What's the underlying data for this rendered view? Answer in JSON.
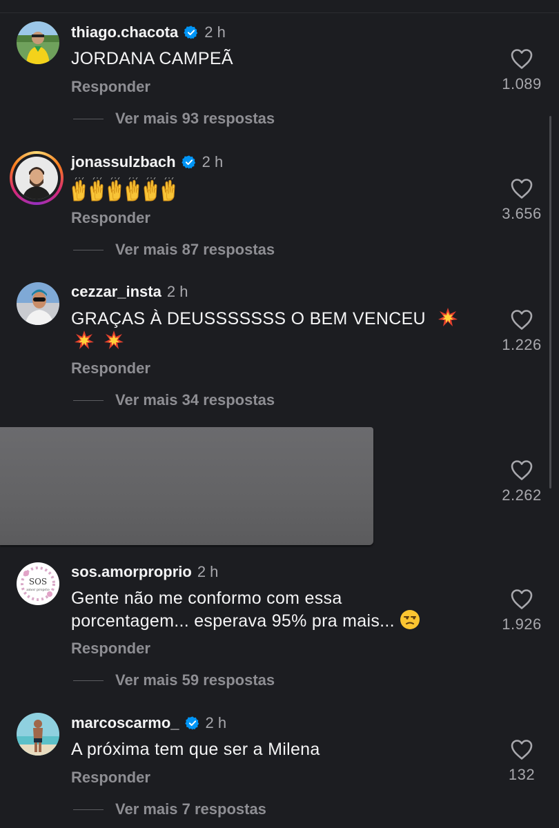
{
  "comments": [
    {
      "username": "thiago.chacota",
      "verified": true,
      "time": "2 h",
      "text": "JORDANA CAMPEÃ",
      "reply_label": "Responder",
      "more_replies": "Ver mais 93 respostas",
      "likes": "1.089",
      "avatar_icon": "avatar-photo"
    },
    {
      "username": "jonassulzbach",
      "verified": true,
      "time": "2 h",
      "text_emoji": "raising-hands-emoji ×6",
      "reply_label": "Responder",
      "more_replies": "Ver mais 87 respostas",
      "likes": "3.656",
      "avatar_icon": "avatar-photo-story-ring"
    },
    {
      "username": "cezzar_insta",
      "verified": false,
      "time": "2 h",
      "text": "GRAÇAS À DEUSSSSSSS O BEM VENCEU",
      "text_emoji": "collision-emoji ×3",
      "reply_label": "Responder",
      "more_replies": "Ver mais 34 respostas",
      "likes": "1.226",
      "avatar_icon": "avatar-photo"
    },
    {
      "redacted": true,
      "likes": "2.262"
    },
    {
      "username": "sos.amorproprio",
      "verified": false,
      "time": "2 h",
      "text_line1": "Gente não me conformo com essa",
      "text_line2": "porcentagem... esperava 95% pra mais...",
      "text_emoji": "unamused-face-emoji",
      "reply_label": "Responder",
      "more_replies": "Ver mais 59 respostas",
      "likes": "1.926",
      "avatar_text": "SOS",
      "avatar_subtext": "amor proprio"
    },
    {
      "username": "marcoscarmo_",
      "verified": true,
      "time": "2 h",
      "text": "A próxima tem que ser a Milena",
      "reply_label": "Responder",
      "more_replies": "Ver mais 7 respostas",
      "likes": "132",
      "avatar_icon": "avatar-photo"
    }
  ],
  "colors": {
    "background": "#1c1d21",
    "verified_badge": "#0095f6",
    "secondary_text": "#8e8e93"
  }
}
